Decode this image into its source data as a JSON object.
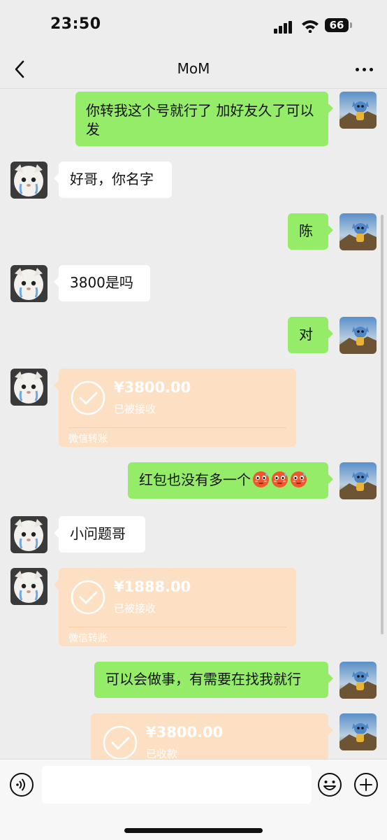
{
  "status_bar": {
    "time": "23:50",
    "battery": "66"
  },
  "header": {
    "title": "MoM"
  },
  "messages": [
    {
      "side": "right",
      "text": "你转我这个号就行了 加好友久了可以发"
    },
    {
      "side": "left",
      "text": "好哥，你名字"
    },
    {
      "side": "right",
      "text": "陈"
    },
    {
      "side": "left",
      "text": "3800是吗"
    },
    {
      "side": "right",
      "text": "对"
    },
    {
      "side": "left",
      "type": "transfer",
      "amount": "¥3800.00",
      "status": "已被接收",
      "footer": "微信转账"
    },
    {
      "side": "right",
      "text": "红包也没有多一个"
    },
    {
      "side": "left",
      "text": "小问题哥"
    },
    {
      "side": "left",
      "type": "transfer",
      "amount": "¥1888.00",
      "status": "已被接收",
      "footer": "微信转账"
    },
    {
      "side": "right",
      "text": "可以会做事，有需要在找我就行"
    },
    {
      "side": "right",
      "type": "transfer",
      "amount": "¥3800.00",
      "status": "已收款"
    }
  ],
  "emoji_suffix": {
    "count": 3,
    "icon": "flushed-face-icon"
  },
  "input": {
    "placeholder": ""
  },
  "colors": {
    "sent_bubble": "#95ec69",
    "received_bubble": "#ffffff",
    "transfer_card": "#fde0c4",
    "background": "#ededed"
  }
}
